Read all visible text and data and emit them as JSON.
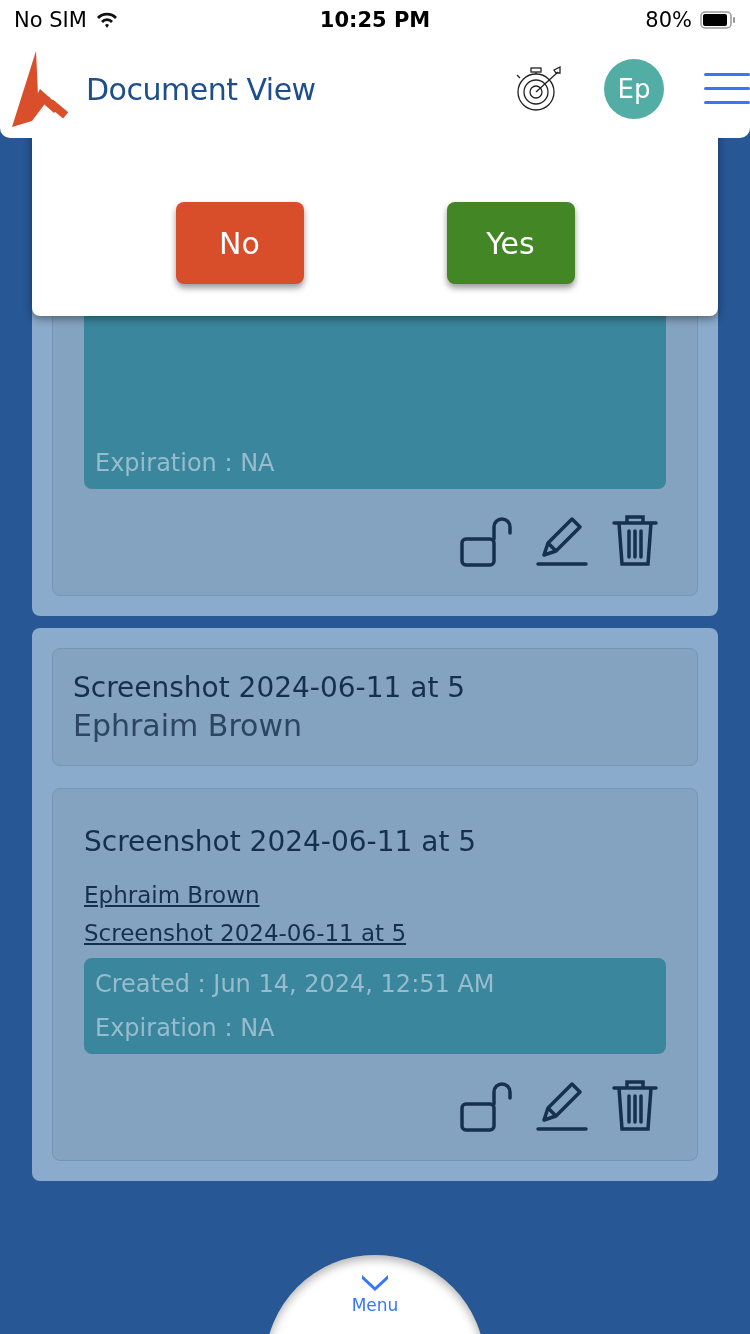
{
  "status_bar": {
    "carrier": "No SIM",
    "time": "10:25 PM",
    "battery": "80%"
  },
  "header": {
    "title": "Document View",
    "avatar": "Ep"
  },
  "dialog": {
    "buttons": [
      {
        "label": "No",
        "kind": "cancel"
      },
      {
        "label": "Yes",
        "kind": "confirm"
      }
    ]
  },
  "documents": [
    {
      "info": [
        "Expiration : NA"
      ]
    },
    {
      "summary_title": "Screenshot 2024-06-11 at 5",
      "summary_author": "Ephraim Brown",
      "title": "Screenshot 2024-06-11 at 5",
      "links": [
        "Ephraim Brown",
        "Screenshot 2024-06-11 at 5"
      ],
      "info": [
        "Created : Jun 14, 2024, 12:51 AM",
        "Expiration : NA"
      ]
    }
  ],
  "bottom_tab": {
    "label": "Menu"
  }
}
